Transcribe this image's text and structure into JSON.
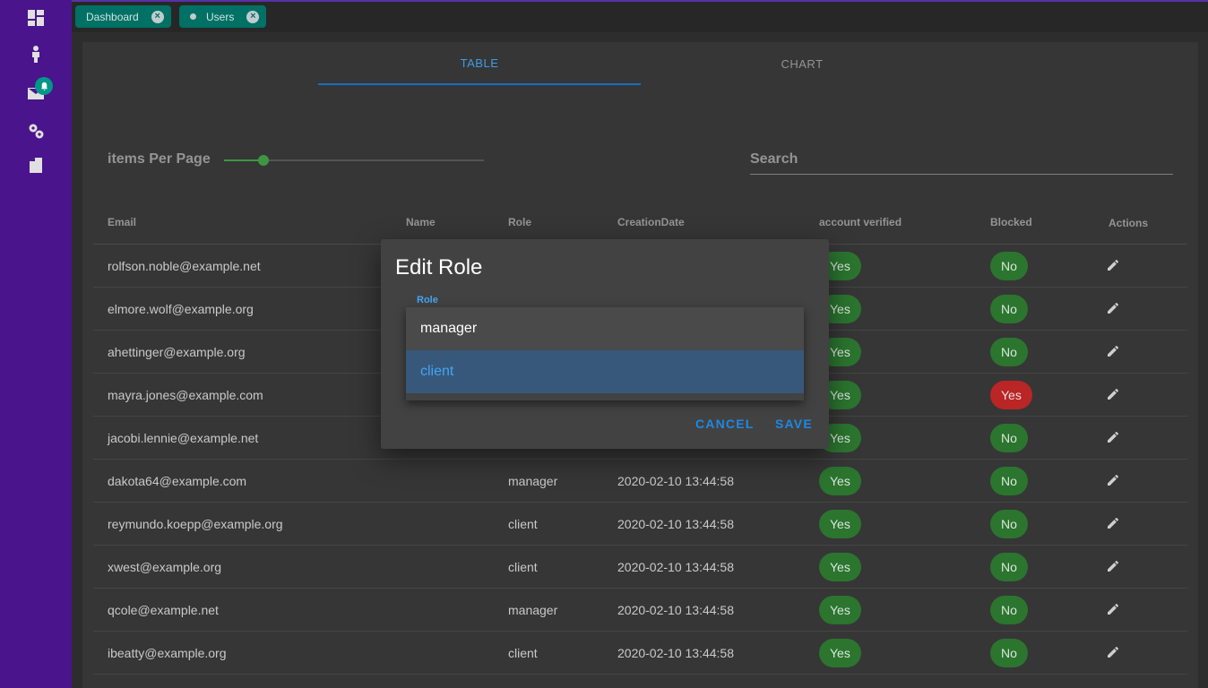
{
  "sidebar": {
    "items": [
      {
        "icon": "dashboard-icon"
      },
      {
        "icon": "person-icon"
      },
      {
        "icon": "mail-icon"
      },
      {
        "icon": "settings-icon"
      },
      {
        "icon": "documents-icon"
      }
    ],
    "badge_icon": "bell-icon"
  },
  "topbar": {
    "chips": [
      {
        "label": "Dashboard"
      },
      {
        "label": "Users"
      }
    ]
  },
  "tabs": [
    "Table",
    "Chart"
  ],
  "controls": {
    "items_per_page_label": "items Per Page",
    "items_per_page_slider_fraction": 0.15,
    "search_label": "Search"
  },
  "table": {
    "headers": [
      "Email",
      "Name",
      "Role",
      "CreationDate",
      "account verified",
      "Blocked",
      "Actions"
    ],
    "rows": [
      {
        "email": "rolfson.noble@example.net",
        "name": "",
        "role": "",
        "date": "",
        "verified": "Yes",
        "blocked": "No"
      },
      {
        "email": "elmore.wolf@example.org",
        "name": "",
        "role": "",
        "date": "",
        "verified": "Yes",
        "blocked": "No"
      },
      {
        "email": "ahettinger@example.org",
        "name": "",
        "role": "",
        "date": "",
        "verified": "Yes",
        "blocked": "No"
      },
      {
        "email": "mayra.jones@example.com",
        "name": "",
        "role": "",
        "date": "",
        "verified": "Yes",
        "blocked": "Yes"
      },
      {
        "email": "jacobi.lennie@example.net",
        "name": "",
        "role": "",
        "date": "",
        "verified": "Yes",
        "blocked": "No"
      },
      {
        "email": "dakota64@example.com",
        "name": "",
        "role": "manager",
        "date": "2020-02-10 13:44:58",
        "verified": "Yes",
        "blocked": "No"
      },
      {
        "email": "reymundo.koepp@example.org",
        "name": "",
        "role": "client",
        "date": "2020-02-10 13:44:58",
        "verified": "Yes",
        "blocked": "No"
      },
      {
        "email": "xwest@example.org",
        "name": "",
        "role": "client",
        "date": "2020-02-10 13:44:58",
        "verified": "Yes",
        "blocked": "No"
      },
      {
        "email": "qcole@example.net",
        "name": "",
        "role": "manager",
        "date": "2020-02-10 13:44:58",
        "verified": "Yes",
        "blocked": "No"
      },
      {
        "email": "ibeatty@example.org",
        "name": "",
        "role": "client",
        "date": "2020-02-10 13:44:58",
        "verified": "Yes",
        "blocked": "No"
      }
    ]
  },
  "dialog": {
    "title": "Edit Role",
    "field_label": "Role",
    "options": [
      "manager",
      "client"
    ],
    "selected": "client",
    "cancel_label": "Cancel",
    "save_label": "Save"
  },
  "colors": {
    "sidebar": "#4a148c",
    "chip": "#00796b",
    "accent": "#1976d2",
    "yes_pill": "#2e7d32",
    "blocked_pill": "#c62828"
  }
}
